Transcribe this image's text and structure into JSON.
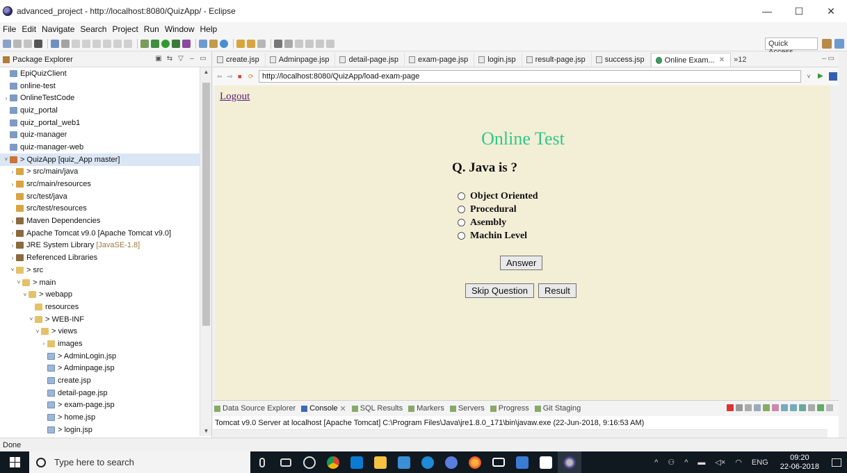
{
  "window": {
    "title": "advanced_project - http://localhost:8080/QuizApp/ - Eclipse",
    "minimize": "—",
    "maximize": "☐",
    "close": "✕"
  },
  "menu": [
    "File",
    "Edit",
    "Navigate",
    "Search",
    "Project",
    "Run",
    "Window",
    "Help"
  ],
  "toolbar": {
    "quick_access": "Quick Access"
  },
  "package_explorer": {
    "title": "Package Explorer",
    "items": [
      {
        "label": "EpiQuizClient",
        "arrow": "",
        "icon": "proj",
        "indent": 0
      },
      {
        "label": "online-test",
        "arrow": "",
        "icon": "proj",
        "indent": 0
      },
      {
        "label": "OnlineTestCode",
        "arrow": "›",
        "icon": "proj",
        "indent": 0
      },
      {
        "label": "quiz_portal",
        "arrow": "",
        "icon": "proj",
        "indent": 0
      },
      {
        "label": "quiz_portal_web1",
        "arrow": "",
        "icon": "proj",
        "indent": 0
      },
      {
        "label": "quiz-manager",
        "arrow": "",
        "icon": "proj",
        "indent": 0
      },
      {
        "label": "quiz-manager-web",
        "arrow": "",
        "icon": "proj",
        "indent": 0
      },
      {
        "label": "> QuizApp [quiz_App master]",
        "arrow": "˅",
        "icon": "git",
        "indent": 0,
        "selected": true
      },
      {
        "label": "> src/main/java",
        "arrow": "›",
        "icon": "src",
        "indent": 1
      },
      {
        "label": "src/main/resources",
        "arrow": "›",
        "icon": "src",
        "indent": 1
      },
      {
        "label": "src/test/java",
        "arrow": "",
        "icon": "src",
        "indent": 1
      },
      {
        "label": "src/test/resources",
        "arrow": "",
        "icon": "src",
        "indent": 1
      },
      {
        "label": "Maven Dependencies",
        "arrow": "›",
        "icon": "lib",
        "indent": 1
      },
      {
        "label": "Apache Tomcat v9.0 [Apache Tomcat v9.0]",
        "arrow": "›",
        "icon": "lib",
        "indent": 1
      },
      {
        "label": "JRE System Library",
        "muted": "[JavaSE-1.8]",
        "arrow": "›",
        "icon": "lib",
        "indent": 1
      },
      {
        "label": "Referenced Libraries",
        "arrow": "›",
        "icon": "lib",
        "indent": 1
      },
      {
        "label": "> src",
        "arrow": "˅",
        "icon": "folder",
        "indent": 1
      },
      {
        "label": "> main",
        "arrow": "˅",
        "icon": "folder",
        "indent": 2
      },
      {
        "label": "> webapp",
        "arrow": "˅",
        "icon": "folder",
        "indent": 3
      },
      {
        "label": "resources",
        "arrow": "",
        "icon": "folder",
        "indent": 4
      },
      {
        "label": "> WEB-INF",
        "arrow": "˅",
        "icon": "folder",
        "indent": 4
      },
      {
        "label": "> views",
        "arrow": "˅",
        "icon": "folder",
        "indent": 5
      },
      {
        "label": "images",
        "arrow": "›",
        "icon": "folder",
        "indent": 6
      },
      {
        "label": "> AdminLogin.jsp",
        "arrow": "",
        "icon": "jsp",
        "indent": 6
      },
      {
        "label": "> Adminpage.jsp",
        "arrow": "",
        "icon": "jsp",
        "indent": 6
      },
      {
        "label": "create.jsp",
        "arrow": "",
        "icon": "jsp",
        "indent": 6
      },
      {
        "label": "detail-page.jsp",
        "arrow": "",
        "icon": "jsp",
        "indent": 6
      },
      {
        "label": "> exam-page.jsp",
        "arrow": "",
        "icon": "jsp",
        "indent": 6
      },
      {
        "label": "> home.jsp",
        "arrow": "",
        "icon": "jsp",
        "indent": 6
      },
      {
        "label": "> login.jsp",
        "arrow": "",
        "icon": "jsp",
        "indent": 6
      }
    ]
  },
  "editor_tabs": [
    "create.jsp",
    "Adminpage.jsp",
    "detail-page.jsp",
    "exam-page.jsp",
    "login.jsp",
    "result-page.jsp",
    "success.jsp",
    "Online Exam..."
  ],
  "tab_overflow": "»12",
  "browser": {
    "url": "http://localhost:8080/QuizApp/load-exam-page"
  },
  "page": {
    "logout": "Logout",
    "title": "Online Test",
    "question": "Q. Java is ?",
    "options": [
      "Object Oriented",
      "Procedural",
      "Asembly",
      "Machin Level"
    ],
    "answer_button": "Answer",
    "skip_button": "Skip Question",
    "result_button": "Result"
  },
  "console": {
    "tabs": [
      "Data Source Explorer",
      "Console",
      "SQL Results",
      "Markers",
      "Servers",
      "Progress",
      "Git Staging"
    ],
    "line": "Tomcat v9.0 Server at localhost [Apache Tomcat] C:\\Program Files\\Java\\jre1.8.0_171\\bin\\javaw.exe (22-Jun-2018, 9:16:53 AM)"
  },
  "status": "Done",
  "taskbar": {
    "search_placeholder": "Type here to search",
    "lang": "ENG",
    "time": "09:20",
    "date": "22-06-2018"
  }
}
